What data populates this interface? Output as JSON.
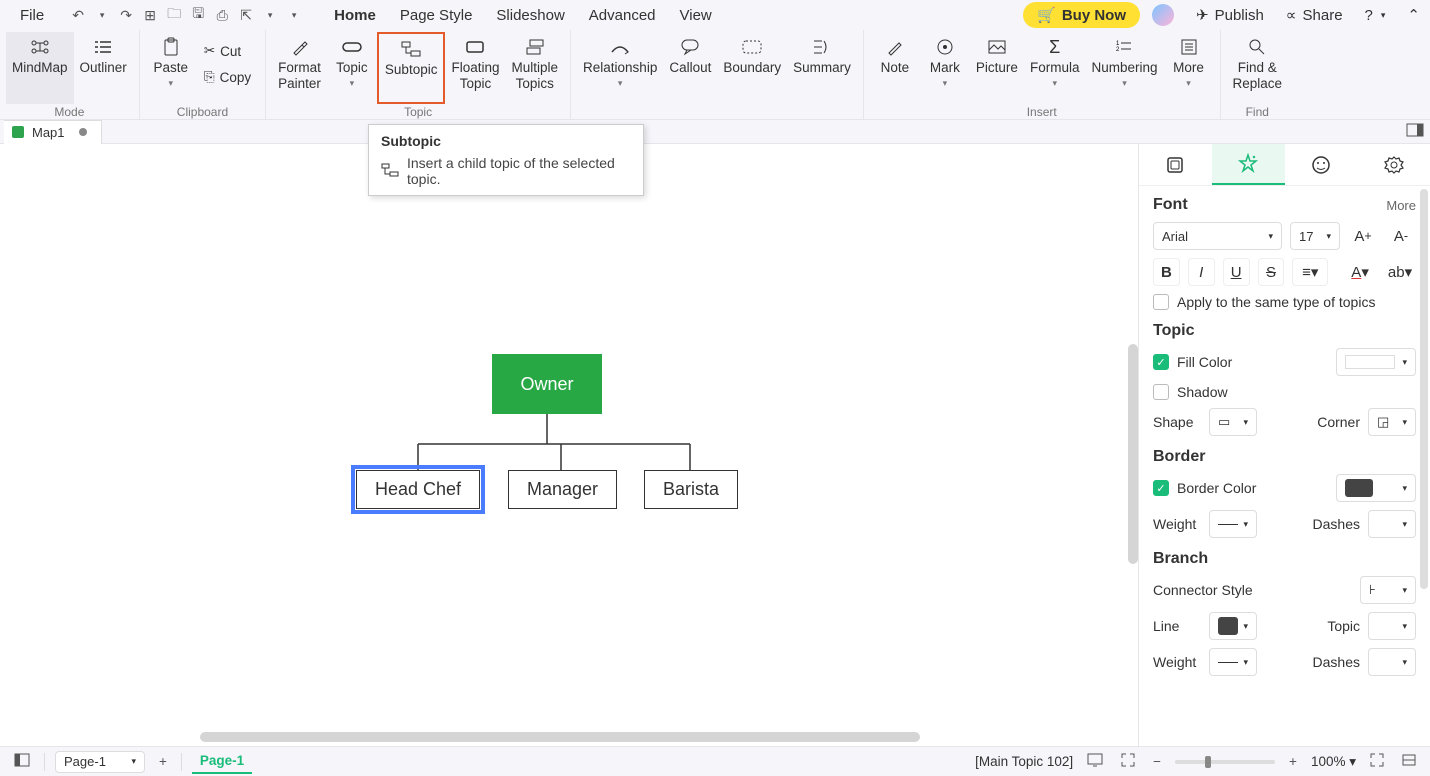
{
  "menu": {
    "file": "File",
    "home": "Home",
    "page_style": "Page Style",
    "slideshow": "Slideshow",
    "advanced": "Advanced",
    "view": "View",
    "buy_now": "Buy Now",
    "publish": "Publish",
    "share": "Share"
  },
  "ribbon": {
    "mode_label": "Mode",
    "clipboard_label": "Clipboard",
    "topic_label": "Topic",
    "insert_label": "Insert",
    "find_label": "Find",
    "mindmap": "MindMap",
    "outliner": "Outliner",
    "paste": "Paste",
    "cut": "Cut",
    "copy": "Copy",
    "format_painter": "Format\nPainter",
    "topic": "Topic",
    "subtopic": "Subtopic",
    "floating_topic": "Floating\nTopic",
    "multiple_topics": "Multiple\nTopics",
    "relationship": "Relationship",
    "callout": "Callout",
    "boundary": "Boundary",
    "summary": "Summary",
    "note": "Note",
    "mark": "Mark",
    "picture": "Picture",
    "formula": "Formula",
    "numbering": "Numbering",
    "more": "More",
    "find_replace": "Find &\nReplace"
  },
  "tooltip": {
    "title": "Subtopic",
    "body": "Insert a child topic of the selected topic."
  },
  "doc_tab": {
    "name": "Map1"
  },
  "canvas_nodes": {
    "owner": "Owner",
    "head_chef": "Head Chef",
    "manager": "Manager",
    "barista": "Barista"
  },
  "panel": {
    "font": {
      "title": "Font",
      "more": "More",
      "family": "Arial",
      "size": "17",
      "apply_same": "Apply to the same type of topics"
    },
    "topic": {
      "title": "Topic",
      "fill_color": "Fill Color",
      "shadow": "Shadow",
      "shape": "Shape",
      "corner": "Corner"
    },
    "border": {
      "title": "Border",
      "border_color": "Border Color",
      "weight": "Weight",
      "dashes": "Dashes"
    },
    "branch": {
      "title": "Branch",
      "connector_style": "Connector Style",
      "line": "Line",
      "topic": "Topic",
      "weight": "Weight",
      "dashes": "Dashes"
    }
  },
  "status": {
    "page_selector": "Page-1",
    "page_tab": "Page-1",
    "info": "[Main Topic 102]",
    "zoom": "100%"
  }
}
